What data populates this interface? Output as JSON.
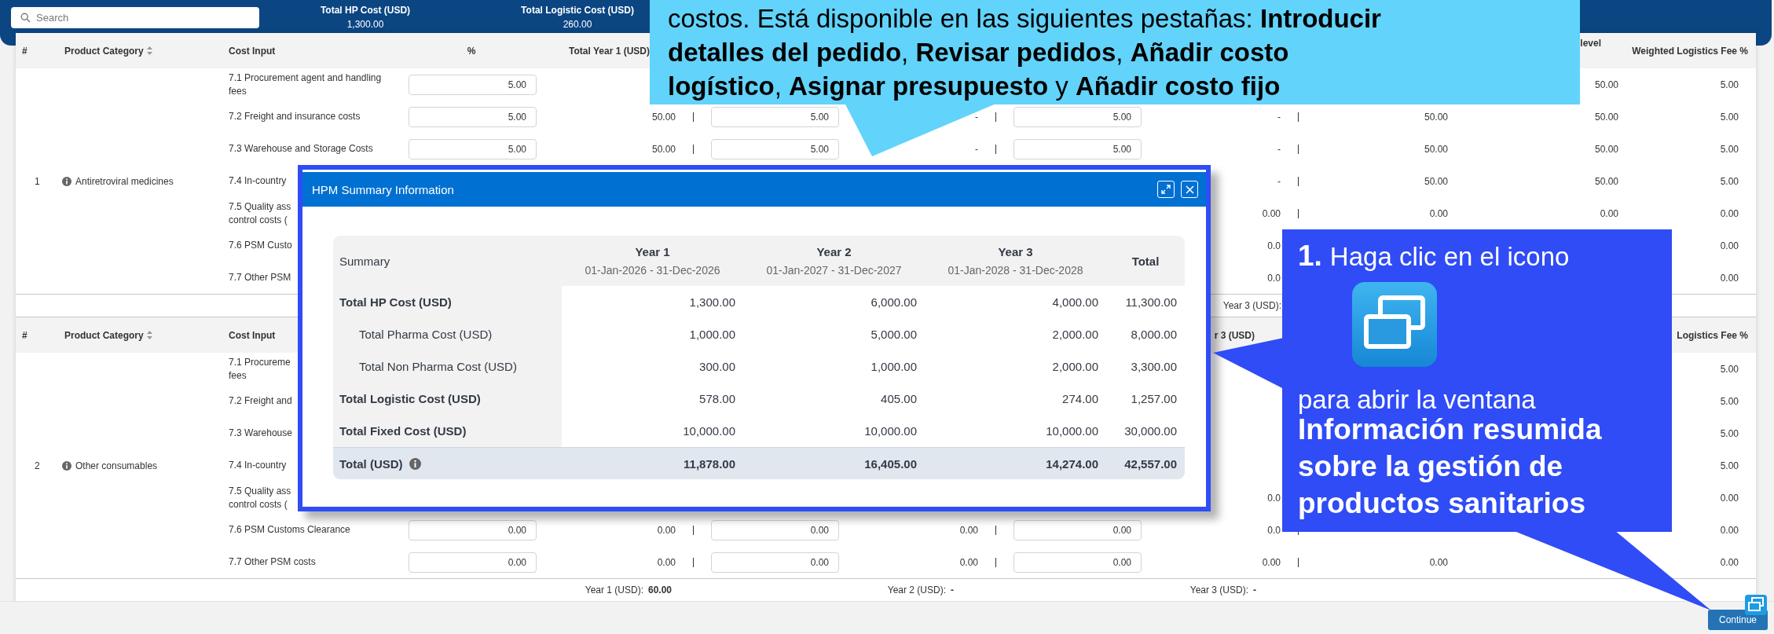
{
  "header": {
    "search": {
      "placeholder": "Search"
    },
    "stats": [
      {
        "label": "Total HP Cost (USD)",
        "value": "1,300.00"
      },
      {
        "label": "Total Logistic Cost (USD)",
        "value": "260.00"
      }
    ]
  },
  "tables": [
    {
      "columns": {
        "number": "#",
        "category": "Product Category",
        "cost_input": "Cost Input",
        "percent": "%",
        "year1_total": "Total Year 1 (USD)",
        "column_11": "level",
        "weighted_fee": "Weighted Logistics Fee %"
      },
      "group": {
        "number": "1",
        "category": "Antiretroviral medicines",
        "rows": [
          {
            "cost_input": "7.1 Procurement agent and handling fees",
            "percent": "5.00",
            "column_11": "50.00",
            "weighted_fee": "5.00"
          },
          {
            "cost_input": "7.2 Freight and insurance costs",
            "percent": "5.00",
            "year1_total": "50.00",
            "year2_input": "5.00",
            "year2_total": "-",
            "year3_input": "5.00",
            "year3_total": "-",
            "column_10": "50.00",
            "column_11": "50.00",
            "weighted_fee": "5.00"
          },
          {
            "cost_input": "7.3 Warehouse and Storage Costs",
            "percent": "5.00",
            "year1_total": "50.00",
            "year2_input": "5.00",
            "year2_total": "-",
            "year3_input": "5.00",
            "year3_total": "-",
            "column_10": "50.00",
            "column_11": "50.00",
            "weighted_fee": "5.00"
          },
          {
            "cost_input": "7.4 In-country",
            "year3_total": "-",
            "column_10": "50.00",
            "column_11": "50.00",
            "weighted_fee": "5.00"
          },
          {
            "cost_input": "7.5 Quality ass\ncontrol costs (",
            "year3_total": "0.00",
            "column_10": "0.00",
            "column_11": "0.00",
            "weighted_fee": "0.00"
          },
          {
            "cost_input": "7.6 PSM Custo",
            "year3_total": "0.0",
            "weighted_fee": "0.00"
          },
          {
            "cost_input": "7.7 Other PSM",
            "year3_total": "0.0",
            "weighted_fee": "0.00"
          }
        ]
      },
      "footer": {
        "year3": {
          "label": "Year 3 (USD):"
        }
      }
    },
    {
      "columns": {
        "number": "#",
        "category": "Product Category",
        "cost_input": "Cost Input",
        "year3_total": "r 3 (USD)",
        "weighted_fee": "Logistics Fee %"
      },
      "group": {
        "number": "2",
        "category": "Other consumables",
        "rows": [
          {
            "cost_input": "7.1 Procureme\nfees",
            "weighted_fee": "5.00"
          },
          {
            "cost_input": "7.2 Freight and",
            "weighted_fee": "5.00"
          },
          {
            "cost_input": "7.3 Warehouse",
            "weighted_fee": "5.00"
          },
          {
            "cost_input": "7.4 In-country",
            "weighted_fee": "5.00"
          },
          {
            "cost_input": "7.5 Quality ass\ncontrol costs (",
            "year3_total": "0.0",
            "weighted_fee": "0.00"
          },
          {
            "cost_input": "7.6 PSM Customs Clearance",
            "percent": "0.00",
            "year1_total": "0.00",
            "year2_input": "0.00",
            "year2_total": "0.00",
            "year3_input": "0.00",
            "year3_total": "0.0",
            "weighted_fee": "0.00"
          },
          {
            "cost_input": "7.7 Other PSM costs",
            "percent": "0.00",
            "year1_total": "0.00",
            "year2_input": "0.00",
            "year2_total": "0.00",
            "year3_input": "0.00",
            "year3_total": "0.00",
            "column_10": "0.00",
            "weighted_fee": "0.00"
          }
        ]
      },
      "footer": {
        "year1": {
          "label": "Year 1 (USD):",
          "value": "60.00"
        },
        "year2": {
          "label": "Year 2 (USD):",
          "value": "-"
        },
        "year3": {
          "label": "Year 3 (USD):",
          "value": "-"
        }
      }
    }
  ],
  "modal": {
    "title": "HPM Summary Information",
    "columns": [
      {
        "label": "Summary"
      },
      {
        "label": "Year 1",
        "period": "01-Jan-2026 - 31-Dec-2026"
      },
      {
        "label": "Year 2",
        "period": "01-Jan-2027 - 31-Dec-2027"
      },
      {
        "label": "Year 3",
        "period": "01-Jan-2028 - 31-Dec-2028"
      },
      {
        "label": "Total"
      }
    ],
    "rows": [
      {
        "kind": "main",
        "label": "Total HP Cost (USD)",
        "values": [
          "1,300.00",
          "6,000.00",
          "4,000.00",
          "11,300.00"
        ]
      },
      {
        "kind": "sub",
        "label": "Total Pharma Cost (USD)",
        "values": [
          "1,000.00",
          "5,000.00",
          "2,000.00",
          "8,000.00"
        ]
      },
      {
        "kind": "sub",
        "label": "Total Non Pharma Cost (USD)",
        "values": [
          "300.00",
          "1,000.00",
          "2,000.00",
          "3,300.00"
        ]
      },
      {
        "kind": "main",
        "label": "Total Logistic Cost (USD)",
        "values": [
          "578.00",
          "405.00",
          "274.00",
          "1,257.00"
        ]
      },
      {
        "kind": "main",
        "label": "Total Fixed Cost (USD)",
        "values": [
          "10,000.00",
          "10,000.00",
          "10,000.00",
          "30,000.00"
        ]
      },
      {
        "kind": "grand",
        "label": "Total (USD)",
        "values": [
          "11,878.00",
          "16,405.00",
          "14,274.00",
          "42,557.00"
        ]
      }
    ]
  },
  "callouts": [
    {
      "kind": "banner",
      "text": "costos. Está disponible en las siguientes pestañas: **Introducir**\n**detalles del pedido**, **Revisar pedidos**, **Añadir costo**\n**logístico**, **Asignar presupuesto** y **Añadir costo fijo**"
    },
    {
      "kind": "step",
      "step": "1.",
      "instruction": "Haga clic en el icono",
      "continuation": "para abrir la ventana",
      "emphasis": "Información resumida sobre la gestión de productos sanitarios"
    }
  ],
  "footer_bar": {
    "button": "Continue"
  }
}
